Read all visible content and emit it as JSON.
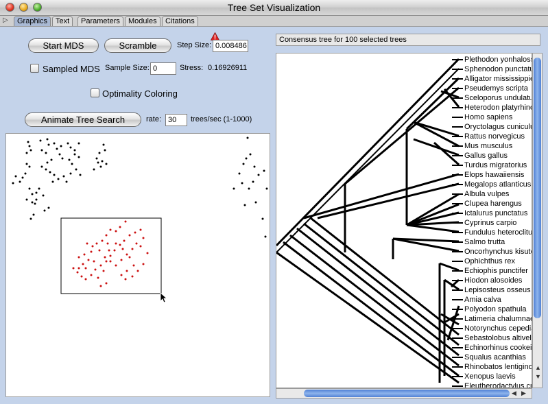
{
  "window": {
    "title": "Tree Set Visualization"
  },
  "tabs": [
    "Graphics",
    "Text",
    "Parameters",
    "Modules",
    "Citations"
  ],
  "controls": {
    "start_mds": "Start MDS",
    "scramble": "Scramble",
    "step_size_label": "Step Size:",
    "step_size_value": "0.008486",
    "sampled_mds": "Sampled MDS",
    "sample_size_label": "Sample Size:",
    "sample_size_value": "0",
    "stress_label": "Stress:",
    "stress_value": "0.16926911",
    "optimality_coloring": "Optimality Coloring",
    "animate": "Animate Tree Search",
    "rate_label": "rate:",
    "rate_value": "30",
    "rate_unit": "trees/sec (1-1000)"
  },
  "tree_panel": {
    "title": "Consensus tree for 100 selected trees",
    "species": [
      "Plethodon yonhalossee",
      "Sphenodon punctatus",
      "Alligator mississippiensis",
      "Pseudemys scripta",
      "Sceloporus undulatus",
      "Heterodon platyrhinos",
      "Homo sapiens",
      "Oryctolagus cuniculus",
      "Rattus norvegicus",
      "Mus musculus",
      "Gallus gallus",
      "Turdus migratorius",
      "Elops hawaiiensis",
      "Megalops atlanticus",
      "Albula vulpes",
      "Clupea harengus",
      "Ictalurus punctatus",
      "Cyprinus carpio",
      "Fundulus heteroclitus",
      "Salmo trutta",
      "Oncorhynchus kisutch",
      "Ophichthus rex",
      "Echiophis punctifer",
      "Hiodon alosoides",
      "Lepisosteus osseus",
      "Amia calva",
      "Polyodon spathula",
      "Latimeria chalumnae",
      "Notorynchus cepedianus",
      "Sebastolobus altivelis",
      "Echinorhinus cookei",
      "Squalus acanthias",
      "Rhinobatos lentiginosus",
      "Xenopus laevis",
      "Eleutherodactylus cuneatus"
    ]
  },
  "colors": {
    "background": "#c4d3ea",
    "selected_points": "#cc1111",
    "points": "#000000",
    "scroll_thumb": "#5f8fdc"
  },
  "icons": {
    "tab_toggle": "triangle-right-icon",
    "warning": "warning-icon",
    "cursor": "arrow-cursor-icon"
  }
}
